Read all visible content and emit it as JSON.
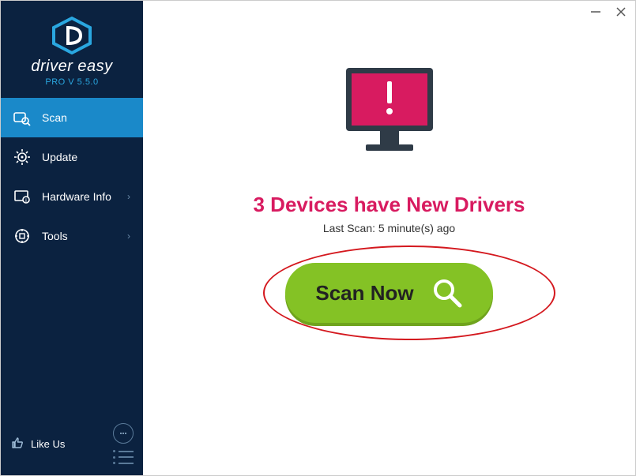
{
  "brand": {
    "name": "driver easy",
    "subtitle": "PRO V 5.5.0"
  },
  "sidebar": {
    "items": [
      {
        "label": "Scan",
        "icon": "scan-icon",
        "active": true,
        "has_submenu": false
      },
      {
        "label": "Update",
        "icon": "update-icon",
        "active": false,
        "has_submenu": false
      },
      {
        "label": "Hardware Info",
        "icon": "hardware-info-icon",
        "active": false,
        "has_submenu": true
      },
      {
        "label": "Tools",
        "icon": "tools-icon",
        "active": false,
        "has_submenu": true
      }
    ],
    "like_us_label": "Like Us"
  },
  "main": {
    "headline": "3 Devices have New Drivers",
    "last_scan": "Last Scan: 5 minute(s) ago",
    "scan_button_label": "Scan Now"
  },
  "window_controls": {
    "minimize": "minimize",
    "close": "close"
  }
}
